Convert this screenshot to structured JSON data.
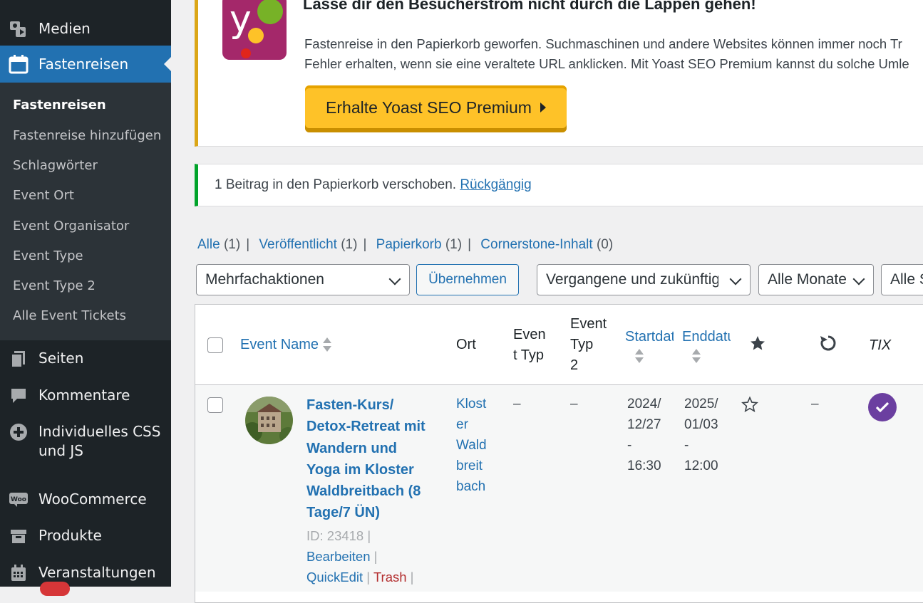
{
  "sidebar": {
    "top_items": [
      {
        "label": "Medien",
        "icon": "media-icon"
      },
      {
        "label": "Fastenreisen",
        "icon": "calendar-icon"
      }
    ],
    "submenu": [
      "Fastenreisen",
      "Fastenreise hinzufügen",
      "Schlagwörter",
      "Event Ort",
      "Event Organisator",
      "Event Type",
      "Event Type 2",
      "Alle Event Tickets"
    ],
    "bottom_items": [
      {
        "label": "Seiten",
        "icon": "pages-icon"
      },
      {
        "label": "Kommentare",
        "icon": "comments-icon"
      },
      {
        "label": "Individuelles CSS und JS",
        "label_line1": "Individuelles CSS",
        "label_line2": "und JS",
        "icon": "plus-circle-icon"
      },
      {
        "label": "WooCommerce",
        "icon": "woocommerce-icon"
      },
      {
        "label": "Produkte",
        "icon": "products-icon"
      },
      {
        "label": "Veranstaltungen",
        "icon": "events-icon"
      }
    ]
  },
  "yoast": {
    "title": "Lasse dir den Besucherstrom nicht durch die Lappen gehen!",
    "line1": "Fastenreise in den Papierkorb geworfen. Suchmaschinen und andere Websites können immer noch Tr",
    "line2": "Fehler erhalten, wenn sie eine veraltete URL anklicken. Mit Yoast SEO Premium kannst du solche Umle",
    "button": "Erhalte Yoast SEO Premium",
    "logo_letter": "y"
  },
  "notice": {
    "text": "1 Beitrag in den Papierkorb verschoben.",
    "undo": "Rückgängig"
  },
  "views": [
    {
      "label": "Alle",
      "count": "(1)"
    },
    {
      "label": "Veröffentlicht",
      "count": "(1)"
    },
    {
      "label": "Papierkorb",
      "count": "(1)"
    },
    {
      "label": "Cornerstone-Inhalt",
      "count": "(0)"
    }
  ],
  "filters": {
    "bulk": "Mehrfachaktionen",
    "apply": "Übernehmen",
    "date_range": "Vergangene und zukünftige",
    "months": "Alle Monate",
    "other": "Alle S"
  },
  "table": {
    "headers": {
      "name": "Event Name",
      "ort": "Ort",
      "typ_l1": "Even",
      "typ_l2": "t Typ",
      "typ2_l1": "Event",
      "typ2_l2": "Typ",
      "typ2_l3": "2",
      "start": "Startdatum",
      "end": "Enddatum",
      "tix": "TIX"
    },
    "rows": [
      {
        "title_lines": [
          "Fasten-Kurs/",
          "Detox-Retreat mit",
          "Wandern und",
          "Yoga im Kloster",
          "Waldbreitbach (8",
          "Tage/7 ÜN)"
        ],
        "id": "ID: 23418",
        "actions": {
          "edit": "Bearbeiten",
          "quickedit": "QuickEdit",
          "trash": "Trash"
        },
        "ort_lines": [
          "Klost",
          "er",
          "Wald",
          "breit",
          "bach"
        ],
        "typ": "–",
        "typ2": "–",
        "start_lines": [
          "2024/",
          "12/27",
          "-",
          "16:30"
        ],
        "end_lines": [
          "2025/",
          "01/03",
          "-",
          "12:00"
        ],
        "recurring": "–"
      }
    ]
  },
  "colors": {
    "accent": "#2271b1",
    "sidebar": "#1d2327",
    "yoast_purple": "#a4286a",
    "yoast_button": "#fec228",
    "success": "#00a32a",
    "tix": "#6b3fa0"
  }
}
